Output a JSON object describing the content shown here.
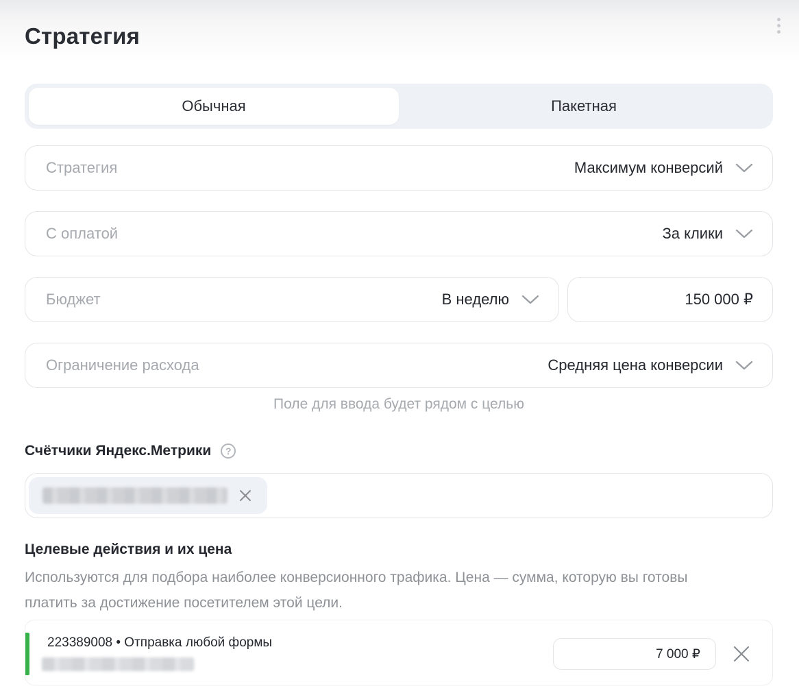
{
  "header": {
    "title": "Стратегия"
  },
  "tabs": [
    {
      "label": "Обычная",
      "active": true
    },
    {
      "label": "Пакетная",
      "active": false
    }
  ],
  "fields": {
    "strategy": {
      "label": "Стратегия",
      "value": "Максимум конверсий"
    },
    "payment": {
      "label": "С оплатой",
      "value": "За клики"
    },
    "budget": {
      "label": "Бюджет",
      "period": "В неделю",
      "amount": "150 000 ₽"
    },
    "limit": {
      "label": "Ограничение расхода",
      "value": "Средняя цена конверсии"
    }
  },
  "hint": "Поле для ввода будет рядом с целью",
  "counters": {
    "title": "Счётчики Яндекс.Метрики",
    "help": "?"
  },
  "goals": {
    "title": "Целевые действия и их цена",
    "description": "Используются для подбора наиболее конверсионного трафика. Цена — сумма, которую вы готовы платить за достижение посетителем этой цели.",
    "items": [
      {
        "name": "223389008 • Отправка любой формы",
        "price": "7 000 ₽"
      }
    ]
  },
  "colors": {
    "accent_green": "#35b24a",
    "segment_bg": "#eef1f6"
  }
}
